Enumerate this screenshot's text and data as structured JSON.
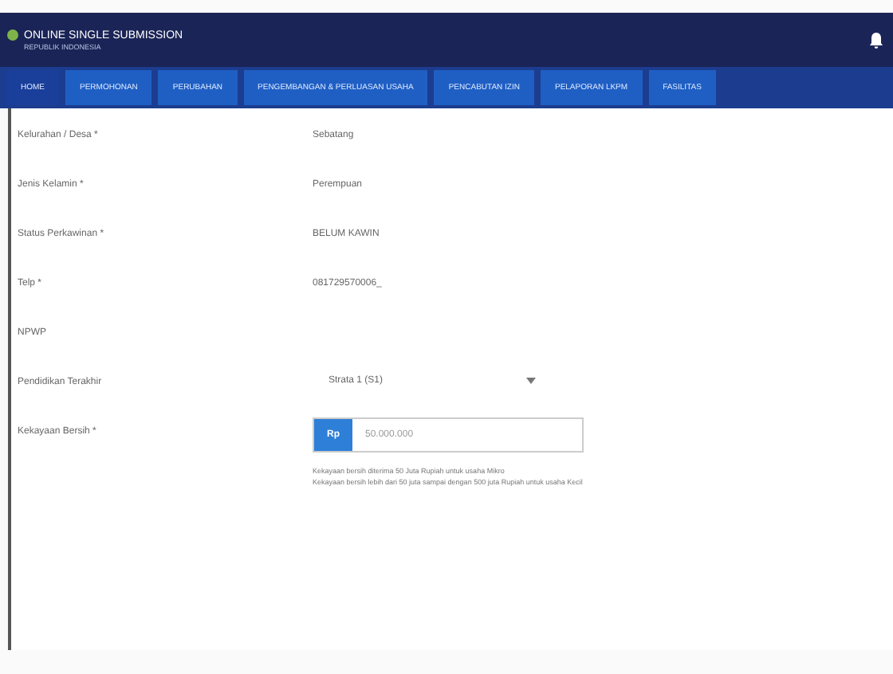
{
  "header": {
    "title": "ONLINE SINGLE SUBMISSION",
    "subtitle": "REPUBLIK INDONESIA"
  },
  "nav": [
    {
      "label": "HOME",
      "selected": true
    },
    {
      "label": "PERMOHONAN",
      "selected": false
    },
    {
      "label": "PERUBAHAN",
      "selected": false
    },
    {
      "label": "PENGEMBANGAN & PERLUASAN USAHA",
      "selected": false
    },
    {
      "label": "PENCABUTAN IZIN",
      "selected": false
    },
    {
      "label": "PELAPORAN LKPM",
      "selected": false
    },
    {
      "label": "FASILITAS",
      "selected": false
    }
  ],
  "fields": [
    {
      "kind": "text",
      "label": "Kelurahan / Desa *",
      "value": "Sebatang"
    },
    {
      "kind": "text",
      "label": "Jenis Kelamin *",
      "value": "Perempuan"
    },
    {
      "kind": "text",
      "label": "Status Perkawinan *",
      "value": "BELUM KAWIN"
    },
    {
      "kind": "text",
      "label": "Telp *",
      "value": "081729570006_"
    },
    {
      "kind": "text",
      "label": "NPWP"
    },
    {
      "kind": "select",
      "label": "Pendidikan Terakhir",
      "value": "Strata 1 (S1)"
    },
    {
      "kind": "money",
      "label": "Kekayaan Bersih *",
      "prefix": "Rp",
      "value": "50.000.000",
      "help": [
        "Kekayaan bersih diterima 50 Juta Rupiah untuk usaha Mikro",
        "Kekayaan bersih lebih dari 50 juta sampai dengan 500 juta Rupiah untuk usaha Kecil"
      ]
    }
  ]
}
